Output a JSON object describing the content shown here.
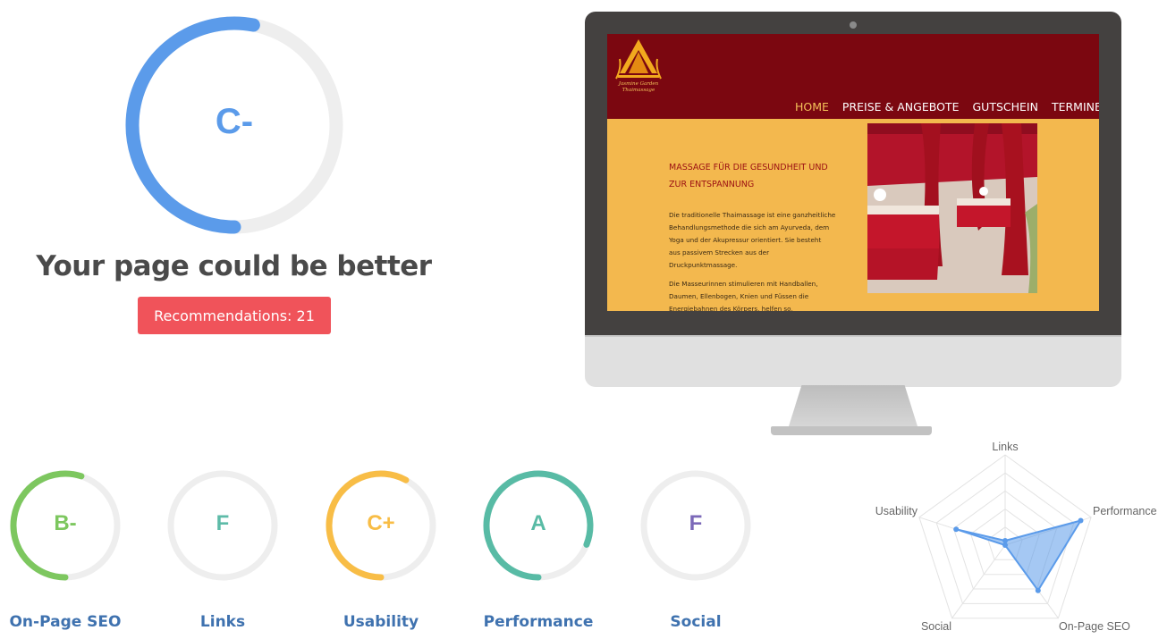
{
  "overall": {
    "grade": "C-",
    "score": 0.53,
    "color": "#5b9bea",
    "headline": "Your page could be better",
    "recommendations_label": "Recommendations: 21",
    "button_color": "#f0535a"
  },
  "website_preview": {
    "logo_lines": [
      "Jasmine Garden",
      "Thaimassage"
    ],
    "nav": [
      "HOME",
      "PREISE & ANGEBOTE",
      "GUTSCHEIN",
      "TERMINE"
    ],
    "active_nav": "HOME",
    "heading_lines": [
      "MASSAGE FÜR DIE GESUNDHEIT UND",
      "ZUR ENTSPANNUNG"
    ],
    "paragraph1_lines": [
      "Die traditionelle Thaimassage ist eine ganzheitliche",
      "Behandlungsmethode die sich am Ayurveda, dem",
      "Yoga und der Akupressur orientiert. Sie besteht",
      "aus passivem Strecken aus der",
      "Druckpunktmassage."
    ],
    "paragraph2_lines": [
      "Die Masseurinnen stimulieren mit Handballen,",
      "Daumen, Ellenbogen, Knien und Füssen die",
      "Energiebahnen des Körpers, helfen so,"
    ],
    "header_color": "#7b0710",
    "body_color": "#f3b84e"
  },
  "categories": [
    {
      "name": "On-Page SEO",
      "grade": "B-",
      "score": 0.55,
      "color": "#7dc75f"
    },
    {
      "name": "Links",
      "grade": "F",
      "score": 0.0,
      "color": "#5dbba8"
    },
    {
      "name": "Usability",
      "grade": "C+",
      "score": 0.58,
      "color": "#f8bd46"
    },
    {
      "name": "Performance",
      "grade": "A",
      "score": 0.81,
      "color": "#58bba5"
    },
    {
      "name": "Social",
      "grade": "F",
      "score": 0.0,
      "color": "#7b68b8"
    }
  ],
  "radar": {
    "axes": [
      "Links",
      "Performance",
      "On-Page SEO",
      "Social",
      "Usability"
    ],
    "values": [
      0.05,
      0.88,
      0.62,
      0.0,
      0.57
    ],
    "fill_color": "#5b9bea"
  }
}
